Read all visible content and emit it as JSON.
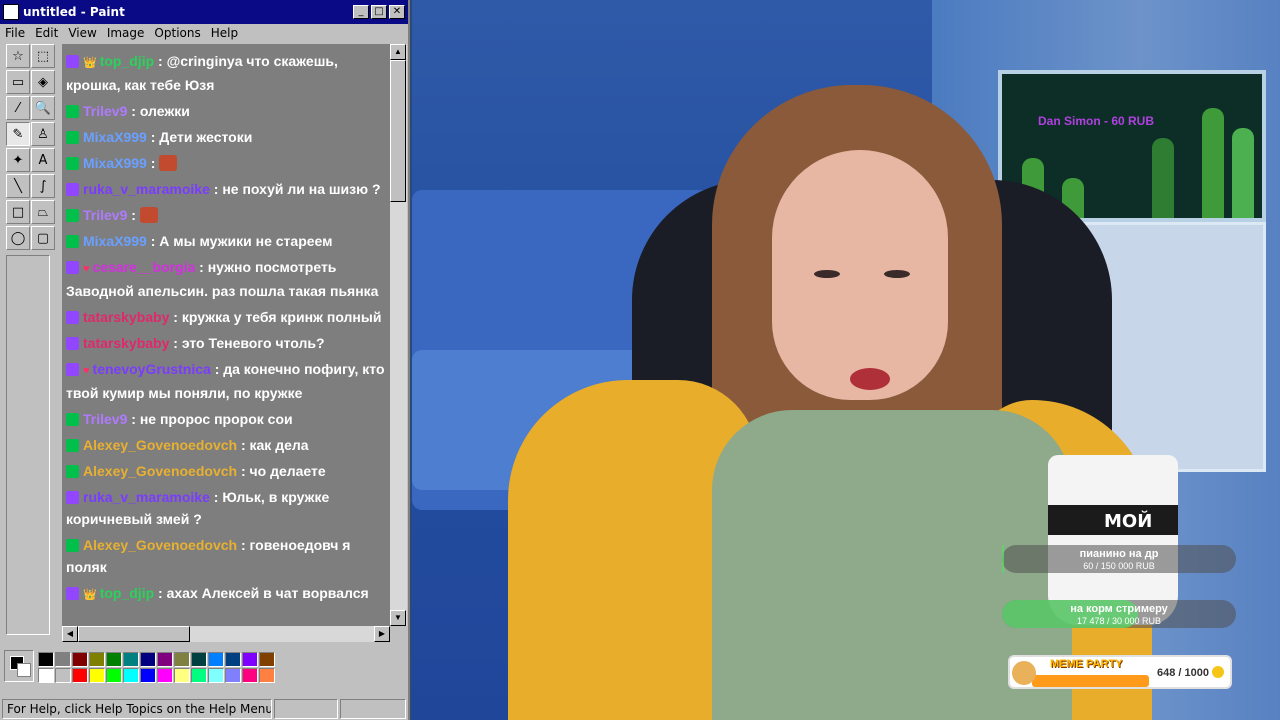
{
  "window": {
    "title": "untitled - Paint",
    "buttons": {
      "minimize": "_",
      "maximize": "□",
      "close": "✕"
    }
  },
  "menu": [
    "File",
    "Edit",
    "View",
    "Image",
    "Options",
    "Help"
  ],
  "tools": [
    {
      "name": "free-form-select",
      "glyph": "☆"
    },
    {
      "name": "select",
      "glyph": "⬚"
    },
    {
      "name": "eraser",
      "glyph": "▭"
    },
    {
      "name": "fill",
      "glyph": "◈"
    },
    {
      "name": "pick-color",
      "glyph": "⁄"
    },
    {
      "name": "magnifier",
      "glyph": "🔍"
    },
    {
      "name": "pencil",
      "glyph": "✎"
    },
    {
      "name": "brush",
      "glyph": "♙"
    },
    {
      "name": "airbrush",
      "glyph": "✦"
    },
    {
      "name": "text",
      "glyph": "A"
    },
    {
      "name": "line",
      "glyph": "╲"
    },
    {
      "name": "curve",
      "glyph": "∫"
    },
    {
      "name": "rectangle",
      "glyph": "□"
    },
    {
      "name": "polygon",
      "glyph": "⏢"
    },
    {
      "name": "ellipse",
      "glyph": "◯"
    },
    {
      "name": "rounded-rectangle",
      "glyph": "▢"
    }
  ],
  "chat": [
    {
      "badge": "sub",
      "crown": "👑",
      "user": "top_djip",
      "color": "#2ad15a",
      "text": ": @cringinya что скажешь, крошка, как тебе Юзя"
    },
    {
      "badge": "kick",
      "user": "Trilev9",
      "color": "#b07aff",
      "text": ": олежки"
    },
    {
      "badge": "kick",
      "user": "MixaX999",
      "color": "#6aa0ff",
      "text": ": Дети жестоки"
    },
    {
      "badge": "kick",
      "user": "MixaX999",
      "color": "#6aa0ff",
      "text": ":",
      "emote": true
    },
    {
      "badge": "sub",
      "user": "ruka_v_maramoike",
      "color": "#7a3cff",
      "text": ": не похуй ли на шизю ?"
    },
    {
      "badge": "kick",
      "user": "Trilev9",
      "color": "#b07aff",
      "text": ":",
      "emote": true
    },
    {
      "badge": "kick",
      "user": "MixaX999",
      "color": "#6aa0ff",
      "text": ": А мы мужики не стареем"
    },
    {
      "badge": "sub",
      "heart": "♥",
      "user": "cesare__borgia",
      "color": "#d42fe0",
      "text": ": нужно посмотреть Заводной апельсин. раз пошла такая пьянка"
    },
    {
      "badge": "sub",
      "user": "tatarskybaby",
      "color": "#e0286a",
      "text": ": кружка у тебя кринж полный"
    },
    {
      "badge": "sub",
      "user": "tatarskybaby",
      "color": "#e0286a",
      "text": ": это Теневого чтоль?"
    },
    {
      "badge": "sub",
      "heart": "♥",
      "user": "tenevoyGrustnica",
      "color": "#7a3cff",
      "text": ": да конечно пофигу, кто твой кумир мы поняли, по кружке"
    },
    {
      "badge": "kick",
      "user": "Trilev9",
      "color": "#b07aff",
      "text": ": не пророс пророк сои"
    },
    {
      "badge": "kick",
      "user": "Alexey_Govenoedovch",
      "color": "#e8b030",
      "text": ": как дела"
    },
    {
      "badge": "kick",
      "user": "Alexey_Govenoedovch",
      "color": "#e8b030",
      "text": ": чо делаете"
    },
    {
      "badge": "sub",
      "user": "ruka_v_maramoike",
      "color": "#7a3cff",
      "text": ": Юльк, в кружке коричневый змей ?"
    },
    {
      "badge": "kick",
      "user": "Alexey_Govenoedovch",
      "color": "#e8b030",
      "text": ": говеноедовч я поляк"
    },
    {
      "badge": "sub",
      "crown": "👑",
      "user": "top_djip",
      "color": "#2ad15a",
      "text": ": ахах Алексей в чат ворвался"
    }
  ],
  "palette": [
    "#000000",
    "#808080",
    "#800000",
    "#808000",
    "#008000",
    "#008080",
    "#000080",
    "#800080",
    "#808040",
    "#004040",
    "#0080ff",
    "#004080",
    "#8000ff",
    "#804000",
    "#ffffff",
    "#c0c0c0",
    "#ff0000",
    "#ffff00",
    "#00ff00",
    "#00ffff",
    "#0000ff",
    "#ff00ff",
    "#ffff80",
    "#00ff80",
    "#80ffff",
    "#8080ff",
    "#ff0080",
    "#ff8040"
  ],
  "status": {
    "help": "For Help, click Help Topics on the Help Menu."
  },
  "scene": {
    "aquarium_label": "Dan Simon - 60 RUB",
    "mug_text": "МОЙ",
    "goal1": {
      "title": "пианино на др",
      "progress": "60 / 150 000 RUB",
      "fraction": 0.0004
    },
    "goal2": {
      "title": "на корм стримеру",
      "progress": "17 478 / 30 000 RUB",
      "fraction": 0.58
    },
    "meme": {
      "title": "MEME PARTY",
      "count": "648 / 1000",
      "fraction": 0.648
    }
  }
}
